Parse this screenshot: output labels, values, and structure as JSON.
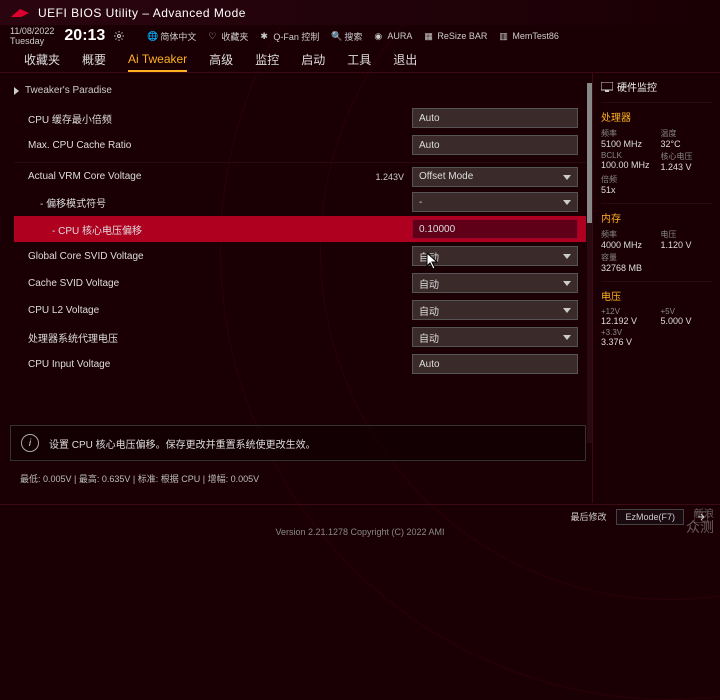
{
  "header": {
    "title": "UEFI BIOS Utility – Advanced Mode"
  },
  "datetime": {
    "date": "11/08/2022",
    "day": "Tuesday",
    "time": "20:13"
  },
  "quicklinks": [
    {
      "name": "lang",
      "label": "简体中文"
    },
    {
      "name": "fav",
      "label": "收藏夹"
    },
    {
      "name": "qfan",
      "label": "Q-Fan 控制"
    },
    {
      "name": "search",
      "label": "搜索"
    },
    {
      "name": "aura",
      "label": "AURA"
    },
    {
      "name": "resize",
      "label": "ReSize BAR"
    },
    {
      "name": "memtest",
      "label": "MemTest86"
    }
  ],
  "tabs": [
    "收藏夹",
    "概要",
    "Ai Tweaker",
    "高级",
    "监控",
    "启动",
    "工具",
    "退出"
  ],
  "active_tab": "Ai Tweaker",
  "section": "Tweaker's Paradise",
  "rows": [
    {
      "label": "CPU 缓存最小倍频",
      "value": "Auto",
      "type": "text",
      "indent": 0
    },
    {
      "label": "Max. CPU Cache Ratio",
      "value": "Auto",
      "type": "text",
      "indent": 0
    },
    {
      "label": "Actual VRM Core Voltage",
      "value": "Offset Mode",
      "type": "dropdown",
      "indent": 0,
      "readout": "1.243V",
      "sep": true
    },
    {
      "label": "- 偏移模式符号",
      "value": "-",
      "type": "dropdown",
      "indent": 1
    },
    {
      "label": "- CPU 核心电压偏移",
      "value": "0.10000",
      "type": "text",
      "indent": 2,
      "hl": true
    },
    {
      "label": "Global Core SVID Voltage",
      "value": "自动",
      "type": "dropdown",
      "indent": 0
    },
    {
      "label": "Cache SVID Voltage",
      "value": "自动",
      "type": "dropdown",
      "indent": 0
    },
    {
      "label": "CPU L2 Voltage",
      "value": "自动",
      "type": "dropdown",
      "indent": 0
    },
    {
      "label": "处理器系统代理电压",
      "value": "自动",
      "type": "dropdown",
      "indent": 0
    },
    {
      "label": "CPU Input Voltage",
      "value": "Auto",
      "type": "text",
      "indent": 0
    }
  ],
  "help_text": "设置 CPU 核心电压偏移。保存更改并重置系统使更改生效。",
  "range_text": "最低:  0.005V  |  最高:  0.635V  |  标准:  根据 CPU  |  增幅:  0.005V",
  "sidebar": {
    "title": "硬件监控",
    "cpu_section": "处理器",
    "cpu": [
      {
        "l": "频率",
        "v": "5100 MHz"
      },
      {
        "l": "温度",
        "v": "32°C"
      },
      {
        "l": "BCLK",
        "v": "100.00 MHz"
      },
      {
        "l": "核心电压",
        "v": "1.243 V"
      },
      {
        "l": "倍频",
        "v": "51x"
      },
      {
        "l": "",
        "v": ""
      }
    ],
    "mem_section": "内存",
    "mem": [
      {
        "l": "频率",
        "v": "4000 MHz"
      },
      {
        "l": "电压",
        "v": "1.120 V"
      },
      {
        "l": "容量",
        "v": "32768 MB"
      },
      {
        "l": "",
        "v": ""
      }
    ],
    "volt_section": "电压",
    "volt": [
      {
        "l": "+12V",
        "v": "12.192 V"
      },
      {
        "l": "+5V",
        "v": "5.000 V"
      },
      {
        "l": "+3.3V",
        "v": "3.376 V"
      },
      {
        "l": "",
        "v": ""
      }
    ]
  },
  "footer": {
    "last_mod": "最后修改",
    "ezmode": "EzMode(F7)"
  },
  "version": "Version 2.21.1278 Copyright (C) 2022 AMI",
  "watermark": {
    "sina": "新浪",
    "zc": "众测"
  }
}
